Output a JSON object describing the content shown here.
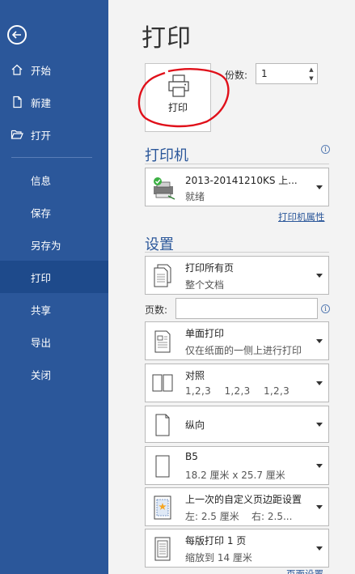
{
  "sidebar": {
    "items": [
      {
        "label": "开始",
        "icon": "home-icon"
      },
      {
        "label": "新建",
        "icon": "new-document-icon"
      },
      {
        "label": "打开",
        "icon": "folder-open-icon"
      },
      {
        "label": "信息"
      },
      {
        "label": "保存"
      },
      {
        "label": "另存为"
      },
      {
        "label": "打印",
        "active": true
      },
      {
        "label": "共享"
      },
      {
        "label": "导出"
      },
      {
        "label": "关闭"
      }
    ]
  },
  "main": {
    "title": "打印",
    "print_button_label": "打印",
    "copies_label": "份数:",
    "copies_value": "1",
    "printer_section": "打印机",
    "printer": {
      "name": "2013-20141210KS 上...",
      "status": "就绪"
    },
    "printer_properties": "打印机属性",
    "settings_section": "设置",
    "pages_label": "页数:",
    "pages_value": "",
    "settings": [
      {
        "line1": "打印所有页",
        "line2": "整个文档"
      },
      {
        "line1": "单面打印",
        "line2": "仅在纸面的一侧上进行打印"
      },
      {
        "line1": "对照",
        "line2": "1,2,3    1,2,3    1,2,3"
      },
      {
        "line1": "纵向",
        "line2": ""
      },
      {
        "line1": "B5",
        "line2": "18.2 厘米 x 25.7 厘米"
      },
      {
        "line1": "上一次的自定义页边距设置",
        "line2": "左: 2.5 厘米    右: 2.5..."
      },
      {
        "line1": "每版打印 1 页",
        "line2": "缩放到 14 厘米"
      }
    ],
    "page_setup_link": "页面设置"
  },
  "colors": {
    "sidebar": "#2b579a",
    "sidebar_active": "#1e4a8b",
    "accent": "#2b579a",
    "annotation": "#e0101a"
  }
}
